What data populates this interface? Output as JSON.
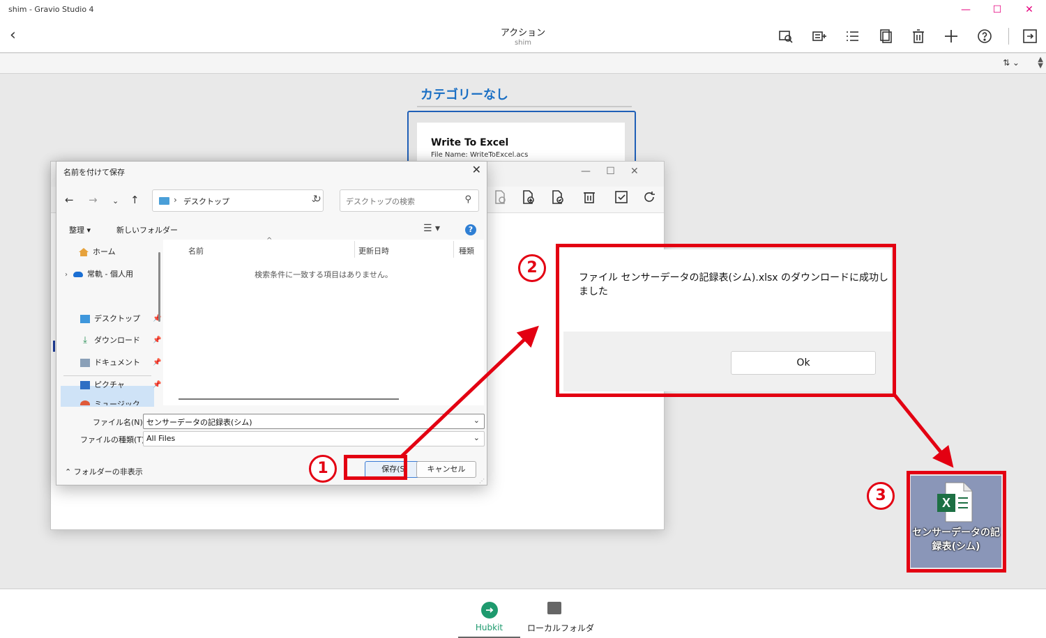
{
  "window": {
    "title": "shim - Gravio Studio 4",
    "controls": [
      "—",
      "☐",
      "✕"
    ]
  },
  "header": {
    "title": "アクション",
    "subtitle": "shim",
    "back": "‹"
  },
  "toolbar_icons": [
    "search-action-icon",
    "add-component-icon",
    "list-icon",
    "copy-icon",
    "trash-icon",
    "plus-icon",
    "help-icon",
    "export-icon"
  ],
  "sort": {
    "label": "⇅ ⌄"
  },
  "category": {
    "title": "カテゴリーなし",
    "action_name": "Write To Excel",
    "action_file": "File Name: WriteToExcel.acs"
  },
  "save_dialog": {
    "title": "名前を付けて保存",
    "address": "デスクトップ",
    "search_placeholder": "デスクトップの検索",
    "organize": "整理 ▾",
    "new_folder": "新しいフォルダー",
    "nav": [
      {
        "label": "ホーム"
      },
      {
        "label": "常軌 - 個人用"
      },
      {
        "label": "デスクトップ"
      },
      {
        "label": "ダウンロード"
      },
      {
        "label": "ドキュメント"
      },
      {
        "label": "ピクチャ"
      },
      {
        "label": "ミュージック"
      }
    ],
    "columns": [
      "名前",
      "更新日時",
      "種類"
    ],
    "empty_message": "検索条件に一致する項目はありません。",
    "filename_label": "ファイル名(N):",
    "filename_value": "センサーデータの記録表(シム)",
    "filetype_label": "ファイルの種類(T):",
    "filetype_value": "All Files",
    "hide_folders": "フォルダーの非表示",
    "save": "保存(S)",
    "cancel": "キャンセル"
  },
  "message_dialog": {
    "text": "ファイル センサーデータの記録表(シム).xlsx のダウンロードに成功しました",
    "ok": "Ok"
  },
  "annotations": {
    "step1": "1",
    "step2": "2",
    "step3": "3"
  },
  "desktop_file": {
    "name": "センサーデータの記録表(シム)"
  },
  "bottom_nav": {
    "hubkit": "Hubkit",
    "local": "ローカルフォルダ"
  },
  "colors": {
    "accent": "#1a6fc4",
    "highlight": "#e30012",
    "hubkit": "#1e9a6e"
  }
}
